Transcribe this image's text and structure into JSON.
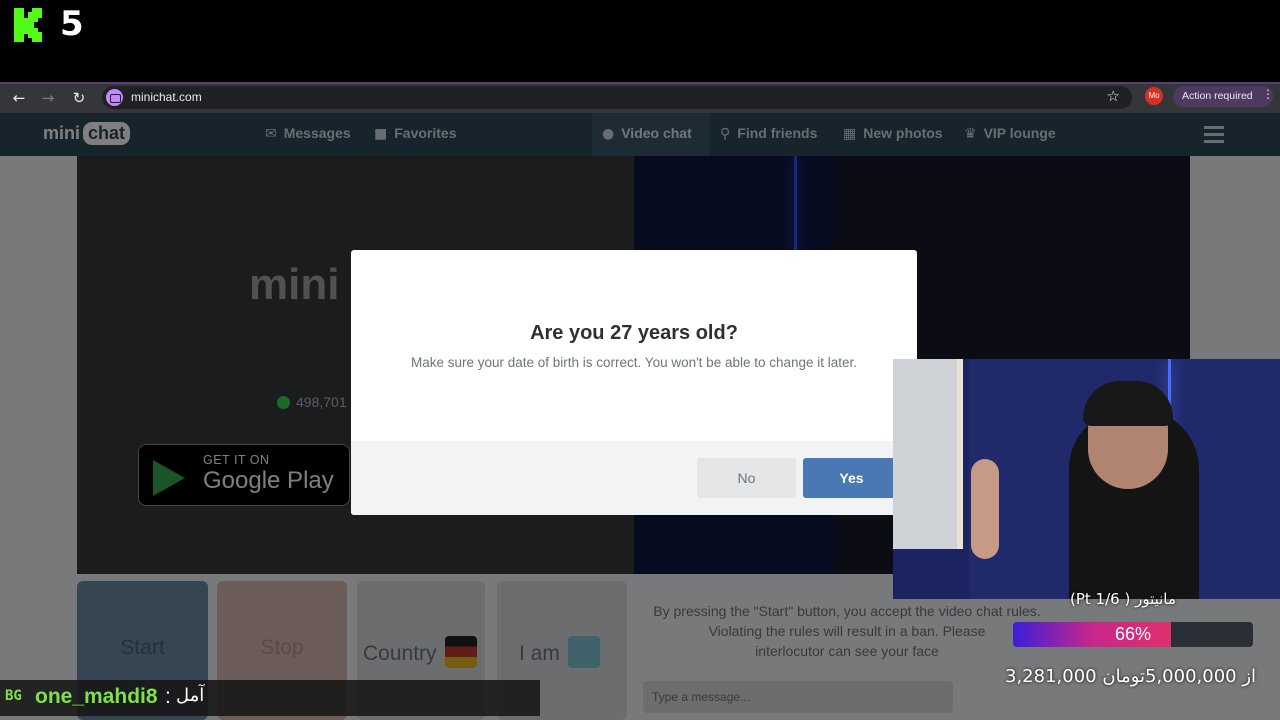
{
  "stream": {
    "channel_badge": "5"
  },
  "browser": {
    "url": "minichat.com",
    "profile_initials": "Mo",
    "action_required": "Action required"
  },
  "site": {
    "logo_mini": "mini",
    "logo_chat": "chat",
    "nav": [
      {
        "label": "Messages",
        "icon": "envelope-icon"
      },
      {
        "label": "Favorites",
        "icon": "bookmark-icon"
      },
      {
        "label": "Video chat",
        "icon": "chat-bubble-icon"
      },
      {
        "label": "Find friends",
        "icon": "search-icon"
      },
      {
        "label": "New photos",
        "icon": "grid-icon"
      },
      {
        "label": "VIP lounge",
        "icon": "crown-icon"
      }
    ],
    "video_logo": "mini",
    "online_count": "498,701",
    "google_play": {
      "get_it_on": "GET IT ON",
      "store_name": "Google Play"
    },
    "buttons": {
      "start": "Start",
      "stop": "Stop",
      "country": "Country",
      "i_am": "I am"
    },
    "rules_lines": [
      "By pressing the \"Start\" button, you accept the video chat rules.",
      "Violating the rules will result in a ban. Please",
      "interlocutor can see your face"
    ],
    "message_placeholder": "Type a message..."
  },
  "dialog": {
    "title": "Are you 27 years old?",
    "text": "Make sure your date of birth is correct. You won't be able to change it later.",
    "no_label": "No",
    "yes_label": "Yes"
  },
  "donation_goal": {
    "title": "مانیتور ( Pt 1/6)",
    "progress_percent": 66,
    "percent_label": "66%",
    "amount_text": "3,281,000 از 5,000,000تومان"
  },
  "chat": {
    "badge": "BG",
    "username": "one_mahdi8",
    "separator": ":",
    "message": "آمل"
  },
  "colors": {
    "nav_bg": "#2f4858",
    "yes_button": "#4a78b5",
    "kick_green": "#53fc18"
  }
}
